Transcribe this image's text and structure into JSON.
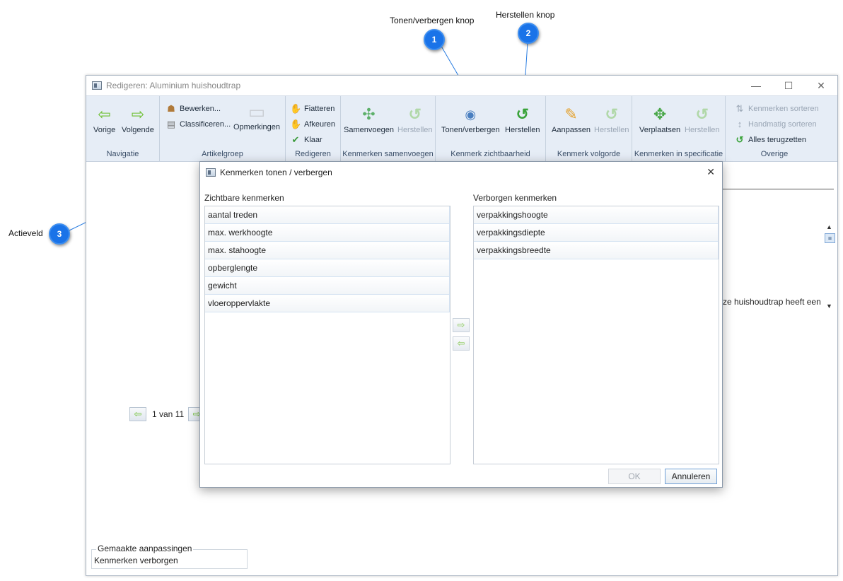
{
  "callouts": [
    {
      "number": "1",
      "label": "Tonen/verbergen knop"
    },
    {
      "number": "2",
      "label": "Herstellen knop"
    },
    {
      "number": "3",
      "label": "Actieveld"
    }
  ],
  "window": {
    "title": "Redigeren: Aluminium huishoudtrap",
    "controls": {
      "minimize": "—",
      "maximize": "☐",
      "close": "✕"
    }
  },
  "ribbon": {
    "groups": [
      {
        "label": "Navigatie",
        "buttons": [
          "Vorige",
          "Volgende"
        ]
      },
      {
        "label": "Artikelgroep",
        "buttons": [
          "Bewerken...",
          "Classificeren...",
          "Opmerkingen"
        ]
      },
      {
        "label": "Redigeren",
        "buttons": [
          "Fiatteren",
          "Afkeuren",
          "Klaar"
        ]
      },
      {
        "label": "Kenmerken samenvoegen",
        "buttons": [
          "Samenvoegen",
          "Herstellen"
        ]
      },
      {
        "label": "Kenmerk zichtbaarheid",
        "buttons": [
          "Tonen/verbergen",
          "Herstellen"
        ]
      },
      {
        "label": "Kenmerk volgorde",
        "buttons": [
          "Aanpassen",
          "Herstellen"
        ]
      },
      {
        "label": "Kenmerken in specificatie",
        "buttons": [
          "Verplaatsen",
          "Herstellen"
        ]
      },
      {
        "label": "Overige",
        "buttons": [
          "Kenmerken sorteren",
          "Handmatig sorteren",
          "Alles terugzetten"
        ]
      }
    ],
    "icons": {
      "prev": "arrow-left-icon",
      "next": "arrow-right-icon",
      "comment": "speech-bubble-icon",
      "eye": "eye-icon",
      "undo": "undo-icon"
    },
    "accent_green": "#3aa33a"
  },
  "background": {
    "description_fragment": "ze huishoudtrap heeft een",
    "pager": "1 van 11",
    "changes_legend": "Gemaakte aanpassingen",
    "changes_value": "Kenmerken verborgen"
  },
  "dialog": {
    "title": "Kenmerken tonen / verbergen",
    "close": "✕",
    "visible_label": "Zichtbare kenmerken",
    "visible_items": [
      "aantal treden",
      "max. werkhoogte",
      "max. stahoogte",
      "opberglengte",
      "gewicht",
      "vloeroppervlakte"
    ],
    "hidden_label": "Verborgen kenmerken",
    "hidden_items": [
      "verpakkingshoogte",
      "verpakkingsdiepte",
      "verpakkingsbreedte"
    ],
    "move_right": "⇨",
    "move_left": "⇦",
    "ok": "OK",
    "cancel": "Annuleren"
  }
}
